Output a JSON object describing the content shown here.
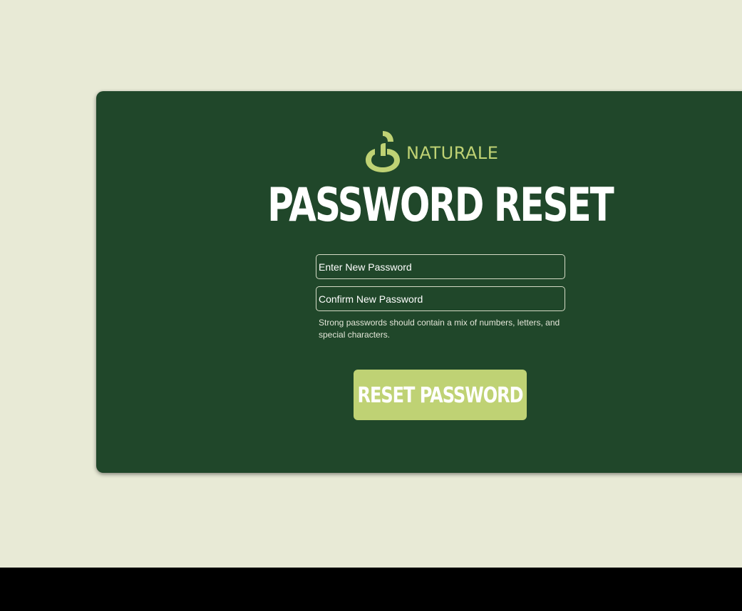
{
  "brand": {
    "name": "NATURALE",
    "logo_icon": "leaf-sprout-icon"
  },
  "title": "PASSWORD RESET",
  "form": {
    "new_password_placeholder": "Enter New Password",
    "confirm_password_placeholder": "Confirm New Password",
    "hint": "Strong passwords should contain a mix of numbers, letters, and special characters.",
    "submit_label": "RESET PASSWORD"
  },
  "colors": {
    "background": "#e8ead6",
    "card": "#20472a",
    "accent": "#bfd274",
    "text": "#ffffff"
  }
}
